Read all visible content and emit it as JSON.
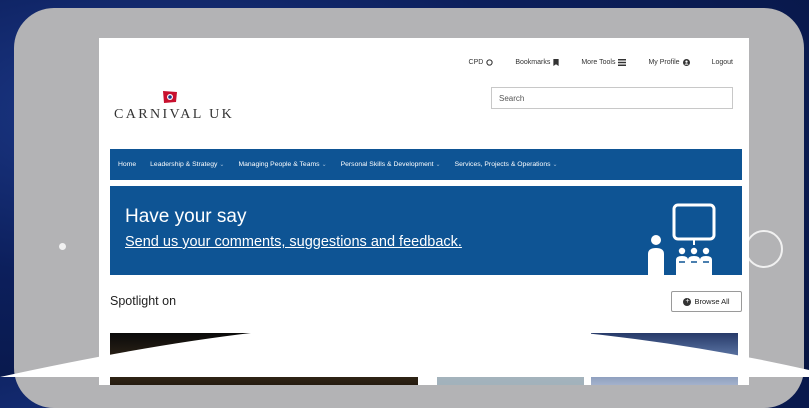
{
  "topbar": {
    "cpd": "CPD",
    "bookmarks": "Bookmarks",
    "more_tools": "More Tools",
    "my_profile": "My Profile",
    "logout": "Logout"
  },
  "logo": {
    "text": "CARNIVAL UK"
  },
  "search": {
    "placeholder": "Search"
  },
  "nav": {
    "items": [
      {
        "label": "Home"
      },
      {
        "label": "Leadership & Strategy"
      },
      {
        "label": "Managing People & Teams"
      },
      {
        "label": "Personal Skills & Development"
      },
      {
        "label": "Services, Projects & Operations"
      }
    ]
  },
  "banner": {
    "title": "Have your say",
    "link": "Send us your comments, suggestions and feedback."
  },
  "spotlight": {
    "title": "Spotlight on",
    "browse_label": "Browse All"
  },
  "colors": {
    "primary_blue": "#0e5494",
    "background": "#0c1f5c",
    "tablet_frame": "#b3b3b5"
  }
}
